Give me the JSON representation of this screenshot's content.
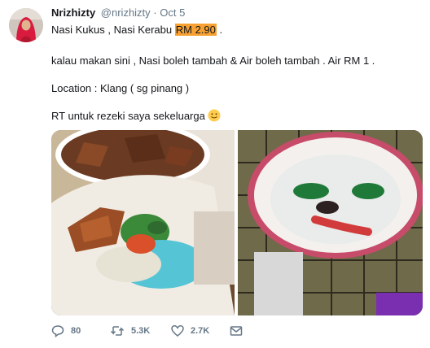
{
  "tweet": {
    "display_name": "Nrizhizty",
    "handle": "@nrizhizty",
    "separator": "·",
    "time": "Oct 5",
    "line1_prefix": "Nasi Kukus , Nasi Kerabu ",
    "line1_price": "RM 2.90",
    "line1_suffix": " .",
    "line2": "kalau makan sini , Nasi boleh tambah & Air boleh tambah . Air RM 1 .",
    "line3": "Location : Klang ( sg pinang )",
    "line4": "RT untuk rezeki saya sekeluarga",
    "emoji_icon": "slightly-smiling-face-icon",
    "highlight_color": "#f7a133"
  },
  "actions": {
    "reply_count": "80",
    "retweet_count": "5.3K",
    "like_count": "2.7K"
  }
}
